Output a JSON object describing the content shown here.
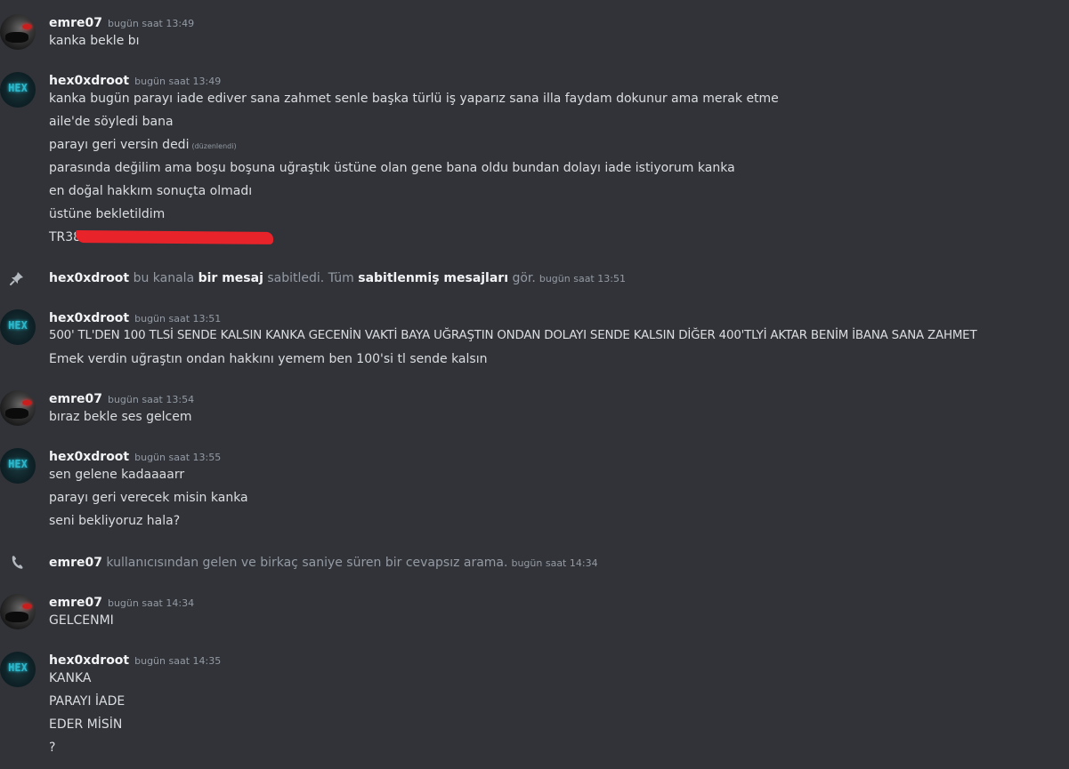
{
  "messages": [
    {
      "user": "emre07",
      "timestamp": "bugün saat 13:49",
      "lines": [
        "kanka bekle bı"
      ]
    },
    {
      "user": "hex0xdroot",
      "timestamp": "bugün saat 13:49",
      "lines": [
        "kanka bugün parayı iade ediver sana zahmet senle başka türlü iş yaparız sana illa faydam dokunur ama merak etme",
        "aile'de söyledi bana",
        "parayı geri versin dedi",
        "parasında değilim ama boşu boşuna uğraştık üstüne olan gene bana oldu bundan dolayı iade istiyorum kanka",
        "en doğal hakkım sonuçta olmadı",
        "üstüne bekletildim",
        "TR38"
      ],
      "edited_label": "(düzenlendi)"
    },
    {
      "user": "hex0xdroot",
      "timestamp": "bugün saat 13:51",
      "lines": [
        "500' TL'DEN 100 TLSİ SENDE KALSIN KANKA GECENİN VAKTİ BAYA UĞRAŞTIN ONDAN DOLAYI SENDE KALSIN DİĞER 400'TLYİ AKTAR BENİM İBANA SANA ZAHMET",
        "Emek verdin uğraştın ondan hakkını yemem ben 100'si tl sende kalsın"
      ]
    },
    {
      "user": "emre07",
      "timestamp": "bugün saat 13:54",
      "lines": [
        "bıraz bekle ses gelcem"
      ]
    },
    {
      "user": "hex0xdroot",
      "timestamp": "bugün saat 13:55",
      "lines": [
        "sen gelene kadaaaarr",
        "parayı geri verecek misin kanka",
        "seni bekliyoruz hala?"
      ]
    },
    {
      "user": "emre07",
      "timestamp": "bugün saat 14:34",
      "lines": [
        "GELCENMI"
      ]
    },
    {
      "user": "hex0xdroot",
      "timestamp": "bugün saat 14:35",
      "lines": [
        "KANKA",
        "PARAYI İADE",
        "EDER MİSİN",
        "?"
      ]
    }
  ],
  "pin_notice": {
    "user": "hex0xdroot",
    "text1": "bu kanala",
    "link1": "bir mesaj",
    "text2": "sabitledi. Tüm",
    "link2": "sabitlenmiş mesajları",
    "text3": "gör.",
    "timestamp": "bugün saat 13:51",
    "icon": "pin-icon"
  },
  "call_notice": {
    "user": "emre07",
    "text": "kullanıcısından gelen ve birkaç saniye süren bir cevapsız arama.",
    "timestamp": "bugün saat 14:34",
    "icon": "phone-icon"
  },
  "avatars": {
    "hex_label": "HEX"
  },
  "colors": {
    "background": "#313338",
    "username": "#f2f3f5",
    "text": "#dbdee1",
    "muted": "#949ba4",
    "redaction": "#e8232a",
    "hex_accent": "#2fb7c9"
  }
}
